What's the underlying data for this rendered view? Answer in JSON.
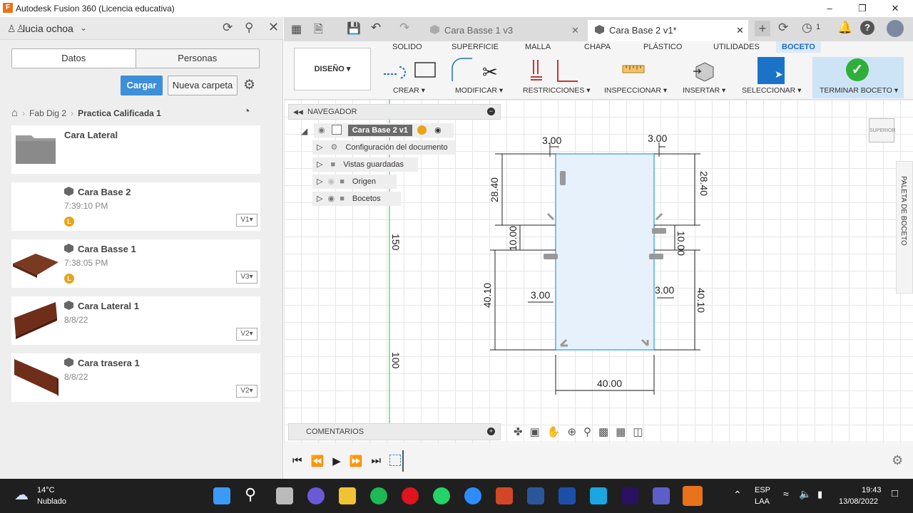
{
  "window": {
    "title": "Autodesk Fusion 360 (Licencia educativa)",
    "app_icon": "F"
  },
  "left": {
    "user": "lucia ochoa",
    "tabs": [
      "Datos",
      "Personas"
    ],
    "upload_label": "Cargar",
    "new_folder_label": "Nueva carpeta",
    "breadcrumb": [
      "Fab Dig 2",
      "Practica Calificada 1"
    ],
    "items": [
      {
        "name": "Cara Lateral",
        "sub": "",
        "version": ""
      },
      {
        "name": "Cara Base 2",
        "sub": "7:39:10 PM",
        "version": "V1▾",
        "badge": "L"
      },
      {
        "name": "Cara Basse 1",
        "sub": "7:38:05 PM",
        "version": "V3▾",
        "badge": "L"
      },
      {
        "name": "Cara Lateral 1",
        "sub": "8/8/22",
        "version": "V2▾"
      },
      {
        "name": "Cara trasera 1",
        "sub": "8/8/22",
        "version": "V2▾"
      }
    ]
  },
  "doc_tabs": [
    {
      "label": "Cara Basse 1 v3",
      "active": false
    },
    {
      "label": "Cara Base 2 v1*",
      "active": true
    }
  ],
  "notif_count": "1",
  "ribbon": {
    "workspace": "DISEÑO ▾",
    "tabs": [
      "SOLIDO",
      "SUPERFICIE",
      "MALLA",
      "CHAPA",
      "PLÁSTICO",
      "UTILIDADES",
      "BOCETO"
    ],
    "groups": [
      "CREAR ▾",
      "MODIFICAR ▾",
      "RESTRICCIONES ▾",
      "INSPECCIONAR ▾",
      "INSERTAR ▾",
      "SELECCIONAR ▾",
      "TERMINAR BOCETO ▾"
    ]
  },
  "browser": {
    "header": "NAVEGADOR",
    "root": "Cara Base 2 v1",
    "nodes": [
      "Configuración del documento",
      "Vistas guardadas",
      "Origen",
      "Bocetos"
    ],
    "comments": "COMENTARIOS"
  },
  "viewcube_label": "SUPERIOR",
  "palette_label": "PALETA DE BOCETO",
  "sketch": {
    "dims": [
      "3.00",
      "3.00",
      "28.40",
      "28.40",
      "10.00",
      "10.00",
      "40.10",
      "40.10",
      "3.00",
      "3.00",
      "40.00"
    ],
    "axis_marks": [
      "150",
      "100"
    ]
  },
  "taskbar": {
    "temp": "14°C",
    "weather": "Nublado",
    "lang1": "ESP",
    "lang2": "LAA",
    "time": "19:43",
    "date": "13/08/2022"
  }
}
